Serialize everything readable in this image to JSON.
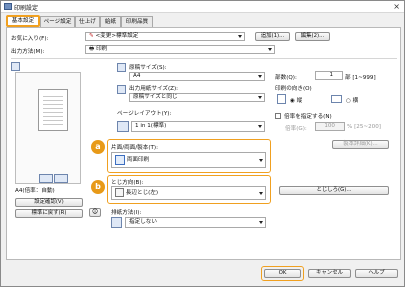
{
  "window": {
    "title": "印刷設定",
    "close": "×"
  },
  "tabs": [
    "基本設定",
    "ページ設定",
    "仕上げ",
    "給紙",
    "印刷品質"
  ],
  "favorites": {
    "label": "お気に入り(F):",
    "value": "<変更>標準設定",
    "add": "追加(1)...",
    "edit": "編集(2)..."
  },
  "output": {
    "label": "出力方法(M):",
    "value": "印刷"
  },
  "paper": {
    "size_label": "原稿サイズ(S):",
    "size_value": "A4",
    "out_label": "出力用紙サイズ(Z):",
    "out_value": "原稿サイズと同じ"
  },
  "layout": {
    "label": "ページレイアウト(Y):",
    "value": "1 in 1(標準)"
  },
  "duplex": {
    "label": "片面/両面/製本(T):",
    "value": "両面印刷",
    "badge": "a"
  },
  "binding": {
    "label": "とじ方向(B):",
    "value": "長辺とじ(左)",
    "badge": "b",
    "margin_btn": "とじしろ(G)..."
  },
  "output_method": {
    "label": "排紙方法(I):",
    "value": "指定しない"
  },
  "copies": {
    "label": "部数(Q):",
    "value": "1",
    "unit": "部 [1~999]"
  },
  "orientation": {
    "label": "印刷の向き(O)",
    "portrait": "縦",
    "landscape": "横"
  },
  "scale": {
    "label": "倍率を指定する(N)",
    "sub": "倍率(G):",
    "value": "100",
    "unit": "% [25~200]",
    "btn": "製本詳細(K)..."
  },
  "preview": {
    "caption": "A4(倍率：自動)",
    "confirm": "設定確認(V)",
    "restore": "標準に戻す(R)"
  },
  "footer": {
    "ok": "OK",
    "cancel": "キャンセル",
    "help": "ヘルプ"
  },
  "colors": {
    "accent": "#f0a020",
    "badge": "#e89a18"
  }
}
